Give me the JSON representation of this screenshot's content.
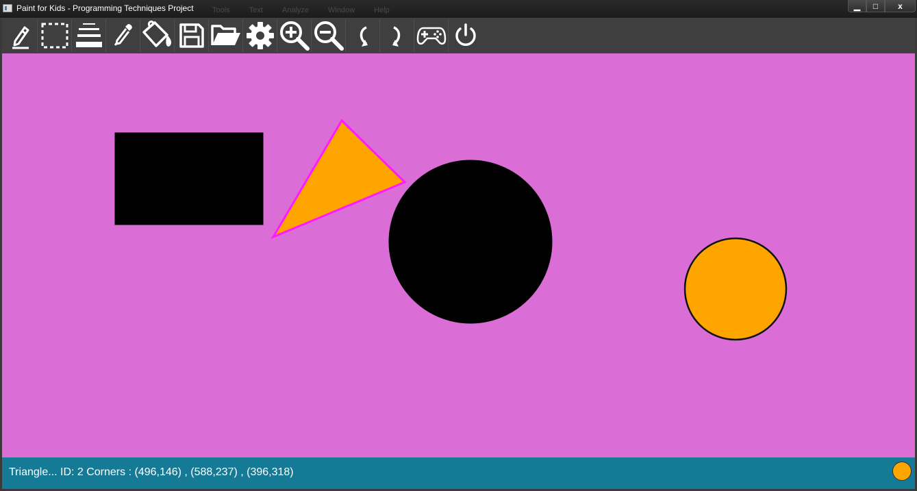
{
  "window": {
    "title": "Paint for Kids - Programming Techniques Project",
    "faded_menu": [
      "Tools",
      "Text",
      "Analyze",
      "Window",
      "Help"
    ],
    "controls": {
      "minimize": "▁",
      "maximize": "□",
      "close": "x"
    }
  },
  "toolbar": {
    "tools": [
      {
        "id": "draw",
        "icon": "pencil-icon"
      },
      {
        "id": "select",
        "icon": "select-marquee-icon"
      },
      {
        "id": "border-width",
        "icon": "line-width-icon"
      },
      {
        "id": "color-picker",
        "icon": "eyedropper-icon"
      },
      {
        "id": "fill",
        "icon": "paint-bucket-icon"
      },
      {
        "id": "save",
        "icon": "save-icon"
      },
      {
        "id": "load",
        "icon": "open-folder-icon"
      },
      {
        "id": "settings",
        "icon": "gear-icon"
      },
      {
        "id": "zoom-in",
        "icon": "zoom-in-icon"
      },
      {
        "id": "zoom-out",
        "icon": "zoom-out-icon"
      },
      {
        "id": "undo",
        "icon": "undo-icon"
      },
      {
        "id": "redo",
        "icon": "redo-icon"
      },
      {
        "id": "play-mode",
        "icon": "gamepad-icon"
      },
      {
        "id": "exit",
        "icon": "power-icon"
      }
    ]
  },
  "canvas": {
    "background_color": "#da6ed6",
    "shapes": [
      {
        "type": "rectangle",
        "fill": "#000000",
        "border": "#000000"
      },
      {
        "type": "triangle",
        "id": 2,
        "fill": "#ffa500",
        "border": "#ff1aff",
        "selected": true
      },
      {
        "type": "circle",
        "fill": "#000000",
        "border": "#000000"
      },
      {
        "type": "circle",
        "fill": "#ffa500",
        "border": "#111111"
      }
    ]
  },
  "status": {
    "message": "Triangle... ID: 2 Corners : (496,146) , (588,237) , (396,318)",
    "current_fill_color": "#ffa500"
  }
}
